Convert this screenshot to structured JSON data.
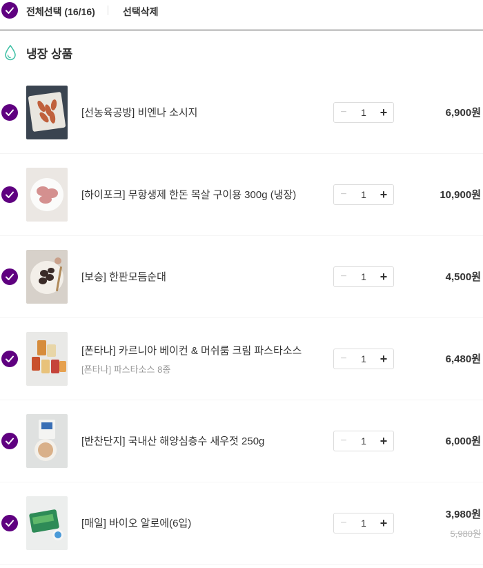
{
  "colors": {
    "accent": "#5f0080"
  },
  "toolbar": {
    "select_all_label": "전체선택 (16/16)",
    "delete_selected_label": "선택삭제"
  },
  "section": {
    "title": "냉장 상품",
    "icon": "water-drop-icon"
  },
  "items": [
    {
      "name": "[선농육공방] 비엔나 소시지",
      "sub": "",
      "qty": "1",
      "price": "6,900원",
      "orig_price": ""
    },
    {
      "name": "[하이포크] 무항생제 한돈 목살 구이용 300g (냉장)",
      "sub": "",
      "qty": "1",
      "price": "10,900원",
      "orig_price": ""
    },
    {
      "name": "[보승] 한판모듬순대",
      "sub": "",
      "qty": "1",
      "price": "4,500원",
      "orig_price": ""
    },
    {
      "name": "[폰타나] 카르니아 베이컨 & 머쉬룸 크림 파스타소스",
      "sub": "[폰타나] 파스타소스 8종",
      "qty": "1",
      "price": "6,480원",
      "orig_price": ""
    },
    {
      "name": "[반찬단지] 국내산 해양심층수 새우젓 250g",
      "sub": "",
      "qty": "1",
      "price": "6,000원",
      "orig_price": ""
    },
    {
      "name": "[매일] 바이오 알로에(6입)",
      "sub": "",
      "qty": "1",
      "price": "3,980원",
      "orig_price": "5,980원"
    }
  ],
  "stepper": {
    "minus_symbol": "−",
    "plus_symbol": "+"
  }
}
